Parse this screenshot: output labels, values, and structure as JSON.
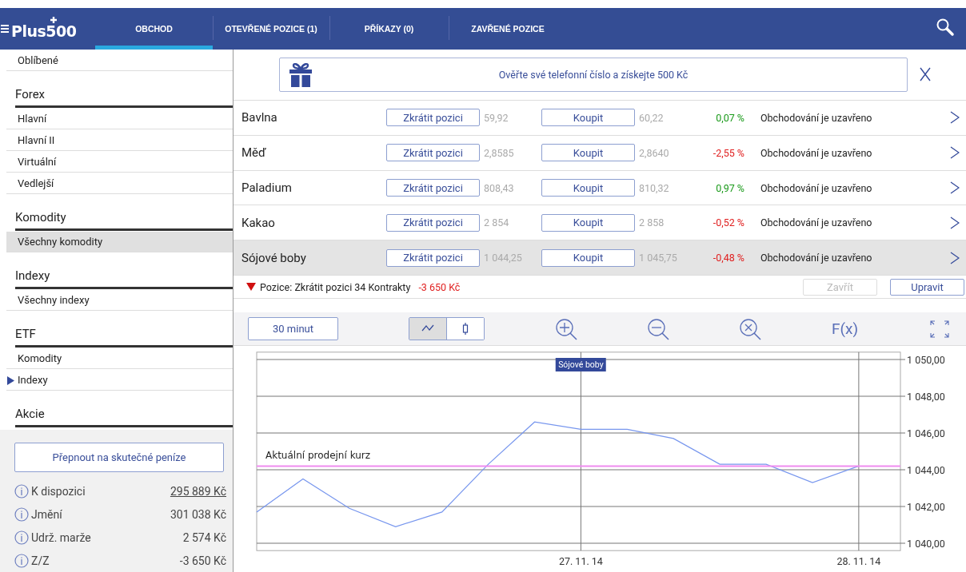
{
  "header": {
    "logo": "Plus500",
    "tabs": [
      {
        "label": "OBCHOD",
        "selected": true
      },
      {
        "label": "OTEVŘENÉ POZICE (1)",
        "selected": false
      },
      {
        "label": "PŘÍKAZY (0)",
        "selected": false
      },
      {
        "label": "ZAVŘENÉ POZICE",
        "selected": false
      }
    ]
  },
  "sidebar": {
    "sections": [
      {
        "items": [
          {
            "label": "Oblíbené",
            "selected": false,
            "marked": false
          }
        ]
      },
      {
        "title": "Forex",
        "items": [
          {
            "label": "Hlavní",
            "selected": false,
            "marked": false
          },
          {
            "label": "Hlavní II",
            "selected": false,
            "marked": false
          },
          {
            "label": "Virtuální",
            "selected": false,
            "marked": false
          },
          {
            "label": "Vedlejší",
            "selected": false,
            "marked": false
          }
        ]
      },
      {
        "title": "Komodity",
        "items": [
          {
            "label": "Všechny komodity",
            "selected": true,
            "marked": false
          }
        ]
      },
      {
        "title": "Indexy",
        "items": [
          {
            "label": "Všechny indexy",
            "selected": false,
            "marked": false
          }
        ]
      },
      {
        "title": "ETF",
        "items": [
          {
            "label": "Komodity",
            "selected": false,
            "marked": false
          },
          {
            "label": "Indexy",
            "selected": false,
            "marked": true
          }
        ]
      },
      {
        "title": "Akcie"
      }
    ],
    "switch_button": "Přepnout na skutečné peníze",
    "account": [
      {
        "label": "K dispozici",
        "value": "295 889 Kč",
        "kind": "link"
      },
      {
        "label": "Jmění",
        "value": "301 038 Kč",
        "kind": "text"
      },
      {
        "label": "Udrž. marže",
        "value": "2 574 Kč",
        "kind": "text"
      },
      {
        "label": "Z/Z",
        "value": "-3 650 Kč",
        "kind": "text"
      }
    ]
  },
  "banner": {
    "text": "Ověřte své telefonní číslo a získejte 500 Kč"
  },
  "instruments": [
    {
      "name": "Bavlna",
      "sell_label": "Zkrátit pozici",
      "sell": "59,92",
      "buy_label": "Koupit",
      "buy": "60,22",
      "change": "0,07 %",
      "color": "#1a9a1a",
      "status": "Obchodování je uzavřeno",
      "selected": false
    },
    {
      "name": "Měď",
      "sell_label": "Zkrátit pozici",
      "sell": "2,8585",
      "buy_label": "Koupit",
      "buy": "2,8640",
      "change": "-2,55 %",
      "color": "#e02020",
      "status": "Obchodování je uzavřeno",
      "selected": false
    },
    {
      "name": "Paladium",
      "sell_label": "Zkrátit pozici",
      "sell": "808,43",
      "buy_label": "Koupit",
      "buy": "810,32",
      "change": "0,97 %",
      "color": "#1a9a1a",
      "status": "Obchodování je uzavřeno",
      "selected": false
    },
    {
      "name": "Kakao",
      "sell_label": "Zkrátit pozici",
      "sell": "2 854",
      "buy_label": "Koupit",
      "buy": "2 858",
      "change": "-0,52 %",
      "color": "#e02020",
      "status": "Obchodování je uzavřeno",
      "selected": false
    },
    {
      "name": "Sójové boby",
      "sell_label": "Zkrátit pozici",
      "sell": "1 044,25",
      "buy_label": "Koupit",
      "buy": "1 045,75",
      "change": "-0,48 %",
      "color": "#e02020",
      "status": "Obchodování je uzavřeno",
      "selected": true
    }
  ],
  "position": {
    "text": "Pozice: Zkrátit pozici 34 Kontrakty",
    "pl": "-3 650 Kč",
    "buttons": [
      {
        "label": "Zavřít",
        "disabled": true
      },
      {
        "label": "Upravit",
        "disabled": false
      }
    ]
  },
  "chart_toolbar": {
    "interval": "30 minut",
    "modes": [
      {
        "kind": "line",
        "selected": true
      },
      {
        "kind": "candle",
        "selected": false
      }
    ],
    "function_label": "F(x)"
  },
  "chart": {
    "chart_data": {
      "type": "line",
      "grid": true,
      "ref_lines": [
        {
          "axis": "y",
          "value": 1044.2,
          "label": "Aktuální prodejní kurz",
          "color": "#f08cf0"
        }
      ],
      "categories": [
        null,
        null,
        null,
        null,
        null,
        null,
        null,
        "27. 11. 14",
        null,
        null,
        null,
        null,
        null,
        "28. 11. 14"
      ],
      "title": "Sójové boby",
      "series": [
        {
          "color": "#7796ee",
          "values": [
            1041.7,
            1043.5,
            1041.9,
            1040.9,
            1041.7,
            1044.3,
            1046.6,
            1046.2,
            1046.2,
            1045.7,
            1044.3,
            1044.3,
            1043.3,
            1044.2
          ]
        }
      ],
      "ylim": [
        1039.6,
        1050.4
      ],
      "yticks": [
        {
          "value": 1040,
          "label": "1 040,00"
        },
        {
          "value": 1042,
          "label": "1 042,00"
        },
        {
          "value": 1044,
          "label": "1 044,00"
        },
        {
          "value": 1046,
          "label": "1 046,00"
        },
        {
          "value": 1048,
          "label": "1 048,00"
        },
        {
          "value": 1050,
          "label": "1 050,00"
        }
      ]
    }
  }
}
